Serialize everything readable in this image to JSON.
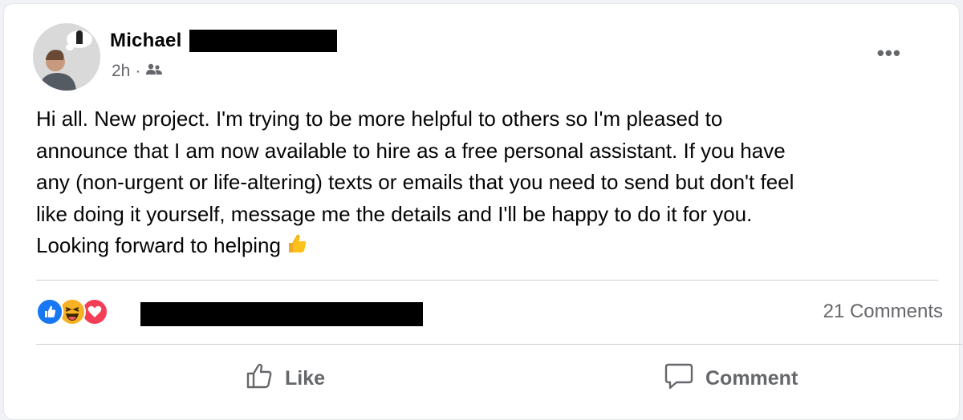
{
  "post": {
    "author": "Michael",
    "time": "2h",
    "separator": "·",
    "audience_icon": "friends-icon",
    "menu_label": "•••",
    "text": "Hi all. New project. I'm trying to be more helpful to others so I'm pleased to\nannounce that I am now available to hire as a free personal assistant. If you have\nany (non-urgent or life-altering) texts or emails that you need to send but don't feel\nlike doing it yourself, message me the details and I'll be happy to do it for you.\nLooking forward to helping",
    "text_emoji": "thumbs-up-emoji"
  },
  "reactions": {
    "icons": [
      "like-reaction-icon",
      "haha-reaction-icon",
      "love-reaction-icon"
    ],
    "colors": {
      "like": "#1877f2",
      "haha": "#f7b125",
      "love": "#f33e58"
    },
    "comments_label": "21 Comments"
  },
  "actions": {
    "like_label": "Like",
    "comment_label": "Comment"
  }
}
